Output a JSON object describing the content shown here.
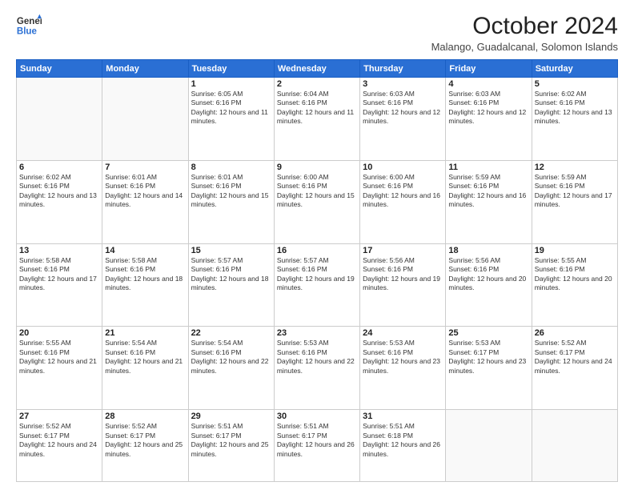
{
  "header": {
    "logo_line1": "General",
    "logo_line2": "Blue",
    "title": "October 2024",
    "subtitle": "Malango, Guadalcanal, Solomon Islands"
  },
  "weekdays": [
    "Sunday",
    "Monday",
    "Tuesday",
    "Wednesday",
    "Thursday",
    "Friday",
    "Saturday"
  ],
  "weeks": [
    [
      {
        "day": "",
        "sunrise": "",
        "sunset": "",
        "daylight": ""
      },
      {
        "day": "",
        "sunrise": "",
        "sunset": "",
        "daylight": ""
      },
      {
        "day": "1",
        "sunrise": "Sunrise: 6:05 AM",
        "sunset": "Sunset: 6:16 PM",
        "daylight": "Daylight: 12 hours and 11 minutes."
      },
      {
        "day": "2",
        "sunrise": "Sunrise: 6:04 AM",
        "sunset": "Sunset: 6:16 PM",
        "daylight": "Daylight: 12 hours and 11 minutes."
      },
      {
        "day": "3",
        "sunrise": "Sunrise: 6:03 AM",
        "sunset": "Sunset: 6:16 PM",
        "daylight": "Daylight: 12 hours and 12 minutes."
      },
      {
        "day": "4",
        "sunrise": "Sunrise: 6:03 AM",
        "sunset": "Sunset: 6:16 PM",
        "daylight": "Daylight: 12 hours and 12 minutes."
      },
      {
        "day": "5",
        "sunrise": "Sunrise: 6:02 AM",
        "sunset": "Sunset: 6:16 PM",
        "daylight": "Daylight: 12 hours and 13 minutes."
      }
    ],
    [
      {
        "day": "6",
        "sunrise": "Sunrise: 6:02 AM",
        "sunset": "Sunset: 6:16 PM",
        "daylight": "Daylight: 12 hours and 13 minutes."
      },
      {
        "day": "7",
        "sunrise": "Sunrise: 6:01 AM",
        "sunset": "Sunset: 6:16 PM",
        "daylight": "Daylight: 12 hours and 14 minutes."
      },
      {
        "day": "8",
        "sunrise": "Sunrise: 6:01 AM",
        "sunset": "Sunset: 6:16 PM",
        "daylight": "Daylight: 12 hours and 15 minutes."
      },
      {
        "day": "9",
        "sunrise": "Sunrise: 6:00 AM",
        "sunset": "Sunset: 6:16 PM",
        "daylight": "Daylight: 12 hours and 15 minutes."
      },
      {
        "day": "10",
        "sunrise": "Sunrise: 6:00 AM",
        "sunset": "Sunset: 6:16 PM",
        "daylight": "Daylight: 12 hours and 16 minutes."
      },
      {
        "day": "11",
        "sunrise": "Sunrise: 5:59 AM",
        "sunset": "Sunset: 6:16 PM",
        "daylight": "Daylight: 12 hours and 16 minutes."
      },
      {
        "day": "12",
        "sunrise": "Sunrise: 5:59 AM",
        "sunset": "Sunset: 6:16 PM",
        "daylight": "Daylight: 12 hours and 17 minutes."
      }
    ],
    [
      {
        "day": "13",
        "sunrise": "Sunrise: 5:58 AM",
        "sunset": "Sunset: 6:16 PM",
        "daylight": "Daylight: 12 hours and 17 minutes."
      },
      {
        "day": "14",
        "sunrise": "Sunrise: 5:58 AM",
        "sunset": "Sunset: 6:16 PM",
        "daylight": "Daylight: 12 hours and 18 minutes."
      },
      {
        "day": "15",
        "sunrise": "Sunrise: 5:57 AM",
        "sunset": "Sunset: 6:16 PM",
        "daylight": "Daylight: 12 hours and 18 minutes."
      },
      {
        "day": "16",
        "sunrise": "Sunrise: 5:57 AM",
        "sunset": "Sunset: 6:16 PM",
        "daylight": "Daylight: 12 hours and 19 minutes."
      },
      {
        "day": "17",
        "sunrise": "Sunrise: 5:56 AM",
        "sunset": "Sunset: 6:16 PM",
        "daylight": "Daylight: 12 hours and 19 minutes."
      },
      {
        "day": "18",
        "sunrise": "Sunrise: 5:56 AM",
        "sunset": "Sunset: 6:16 PM",
        "daylight": "Daylight: 12 hours and 20 minutes."
      },
      {
        "day": "19",
        "sunrise": "Sunrise: 5:55 AM",
        "sunset": "Sunset: 6:16 PM",
        "daylight": "Daylight: 12 hours and 20 minutes."
      }
    ],
    [
      {
        "day": "20",
        "sunrise": "Sunrise: 5:55 AM",
        "sunset": "Sunset: 6:16 PM",
        "daylight": "Daylight: 12 hours and 21 minutes."
      },
      {
        "day": "21",
        "sunrise": "Sunrise: 5:54 AM",
        "sunset": "Sunset: 6:16 PM",
        "daylight": "Daylight: 12 hours and 21 minutes."
      },
      {
        "day": "22",
        "sunrise": "Sunrise: 5:54 AM",
        "sunset": "Sunset: 6:16 PM",
        "daylight": "Daylight: 12 hours and 22 minutes."
      },
      {
        "day": "23",
        "sunrise": "Sunrise: 5:53 AM",
        "sunset": "Sunset: 6:16 PM",
        "daylight": "Daylight: 12 hours and 22 minutes."
      },
      {
        "day": "24",
        "sunrise": "Sunrise: 5:53 AM",
        "sunset": "Sunset: 6:16 PM",
        "daylight": "Daylight: 12 hours and 23 minutes."
      },
      {
        "day": "25",
        "sunrise": "Sunrise: 5:53 AM",
        "sunset": "Sunset: 6:17 PM",
        "daylight": "Daylight: 12 hours and 23 minutes."
      },
      {
        "day": "26",
        "sunrise": "Sunrise: 5:52 AM",
        "sunset": "Sunset: 6:17 PM",
        "daylight": "Daylight: 12 hours and 24 minutes."
      }
    ],
    [
      {
        "day": "27",
        "sunrise": "Sunrise: 5:52 AM",
        "sunset": "Sunset: 6:17 PM",
        "daylight": "Daylight: 12 hours and 24 minutes."
      },
      {
        "day": "28",
        "sunrise": "Sunrise: 5:52 AM",
        "sunset": "Sunset: 6:17 PM",
        "daylight": "Daylight: 12 hours and 25 minutes."
      },
      {
        "day": "29",
        "sunrise": "Sunrise: 5:51 AM",
        "sunset": "Sunset: 6:17 PM",
        "daylight": "Daylight: 12 hours and 25 minutes."
      },
      {
        "day": "30",
        "sunrise": "Sunrise: 5:51 AM",
        "sunset": "Sunset: 6:17 PM",
        "daylight": "Daylight: 12 hours and 26 minutes."
      },
      {
        "day": "31",
        "sunrise": "Sunrise: 5:51 AM",
        "sunset": "Sunset: 6:18 PM",
        "daylight": "Daylight: 12 hours and 26 minutes."
      },
      {
        "day": "",
        "sunrise": "",
        "sunset": "",
        "daylight": ""
      },
      {
        "day": "",
        "sunrise": "",
        "sunset": "",
        "daylight": ""
      }
    ]
  ]
}
